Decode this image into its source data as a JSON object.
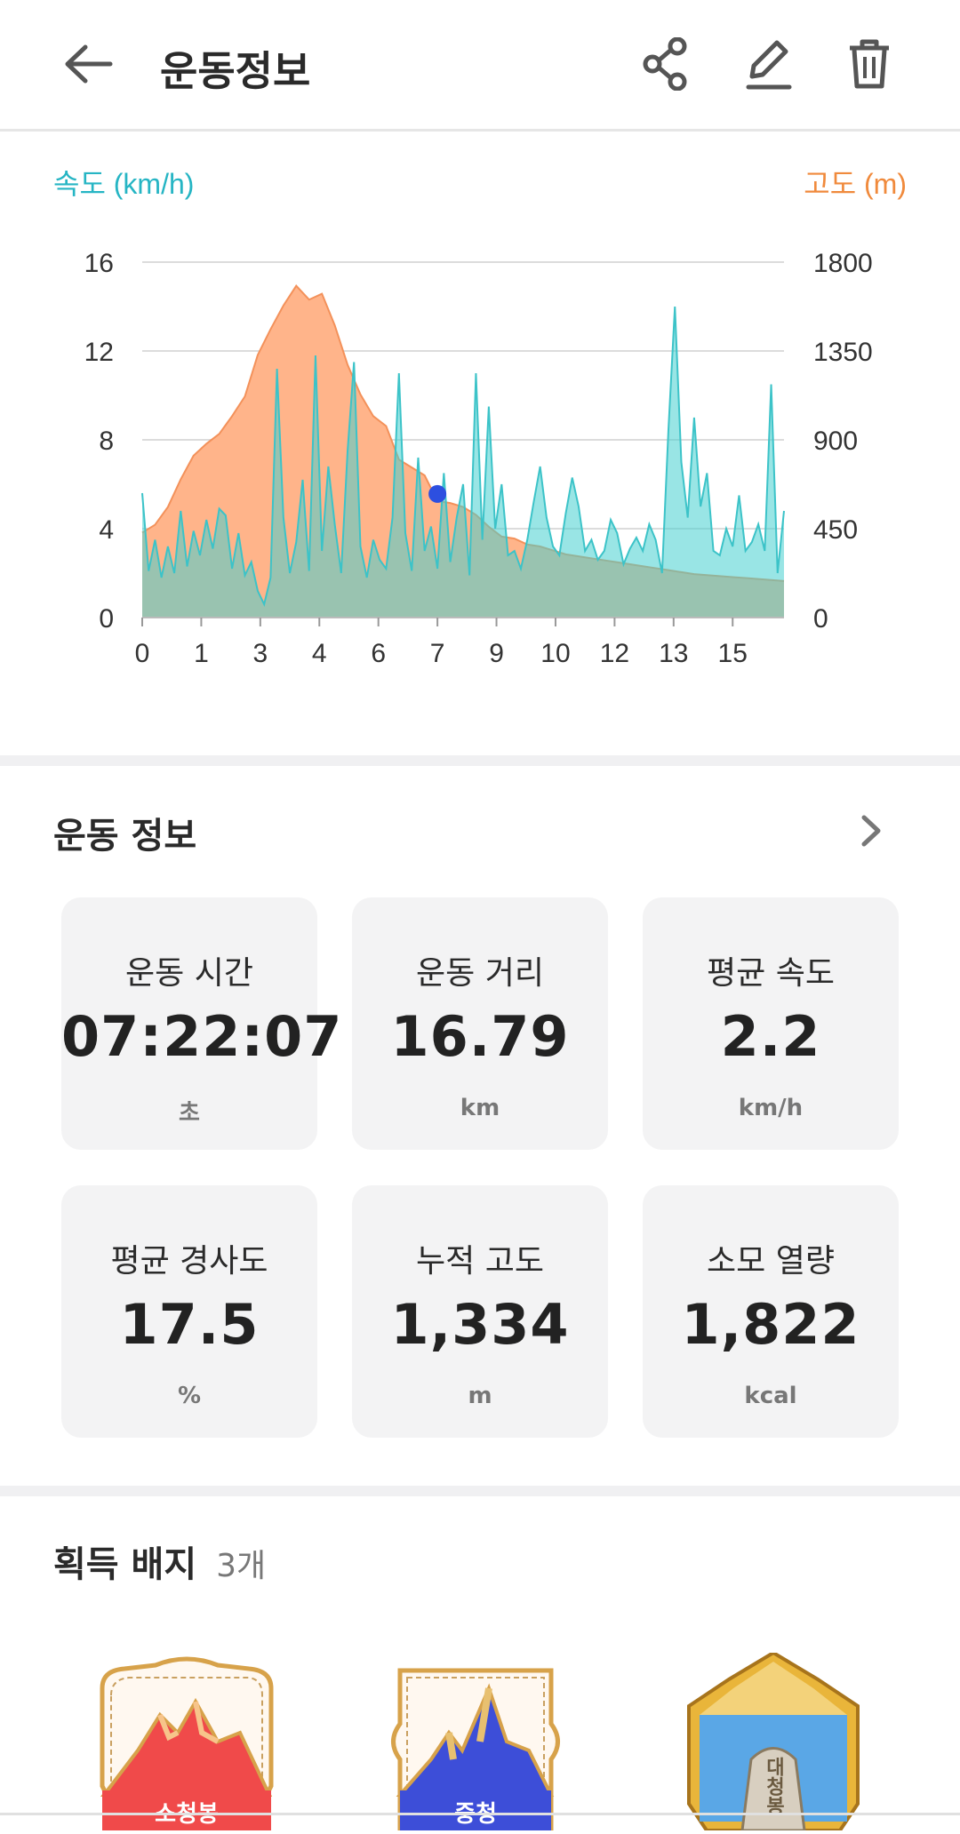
{
  "header": {
    "title": "운동정보",
    "back_icon": "arrow-left-icon",
    "share_icon": "share-icon",
    "edit_icon": "pencil-icon",
    "delete_icon": "trash-icon"
  },
  "chart_data": {
    "type": "area",
    "speed_axis_label": "속도 (km/h)",
    "altitude_axis_label": "고도 (m)",
    "x_ticks": [
      "0",
      "1",
      "3",
      "4",
      "6",
      "7",
      "9",
      "10",
      "12",
      "13",
      "15"
    ],
    "y_left_ticks": [
      "16",
      "12",
      "8",
      "4",
      "0"
    ],
    "y_right_ticks": [
      "1800",
      "1350",
      "900",
      "450",
      "0"
    ],
    "ylim_speed": [
      0,
      16
    ],
    "ylim_altitude": [
      0,
      1800
    ],
    "grid": true,
    "colors": {
      "speed": "#46cfd0",
      "altitude": "#ffb48a",
      "marker": "#2d4fe0",
      "speed_label": "#26b5c4",
      "altitude_label": "#f08a3c"
    },
    "series": [
      {
        "name": "고도 (m)",
        "x_norm": [
          0,
          0.02,
          0.04,
          0.06,
          0.08,
          0.1,
          0.12,
          0.14,
          0.16,
          0.18,
          0.2,
          0.22,
          0.24,
          0.26,
          0.28,
          0.3,
          0.32,
          0.34,
          0.36,
          0.38,
          0.4,
          0.42,
          0.44,
          0.46,
          0.48,
          0.5,
          0.52,
          0.54,
          0.56,
          0.58,
          0.6,
          0.62,
          0.64,
          0.66,
          0.68,
          0.7,
          0.72,
          0.74,
          0.76,
          0.78,
          0.8,
          0.82,
          0.84,
          0.86,
          0.88,
          0.9,
          0.92,
          0.94,
          0.96,
          0.98,
          1.0
        ],
        "values": [
          430,
          470,
          560,
          700,
          820,
          880,
          930,
          1020,
          1120,
          1330,
          1460,
          1580,
          1680,
          1610,
          1640,
          1480,
          1280,
          1130,
          1020,
          970,
          800,
          760,
          720,
          590,
          580,
          560,
          520,
          460,
          410,
          400,
          370,
          360,
          340,
          320,
          310,
          300,
          290,
          280,
          270,
          260,
          250,
          240,
          230,
          220,
          215,
          210,
          205,
          200,
          195,
          190,
          185
        ]
      },
      {
        "name": "속도 (km/h)",
        "x_norm": [
          0,
          0.01,
          0.02,
          0.03,
          0.04,
          0.05,
          0.06,
          0.07,
          0.08,
          0.09,
          0.1,
          0.11,
          0.12,
          0.13,
          0.14,
          0.15,
          0.16,
          0.17,
          0.18,
          0.19,
          0.2,
          0.21,
          0.22,
          0.23,
          0.24,
          0.25,
          0.26,
          0.27,
          0.28,
          0.29,
          0.3,
          0.31,
          0.32,
          0.33,
          0.34,
          0.35,
          0.36,
          0.37,
          0.38,
          0.39,
          0.4,
          0.41,
          0.42,
          0.43,
          0.44,
          0.45,
          0.46,
          0.47,
          0.48,
          0.49,
          0.5,
          0.51,
          0.52,
          0.53,
          0.54,
          0.55,
          0.56,
          0.57,
          0.58,
          0.59,
          0.6,
          0.61,
          0.62,
          0.63,
          0.64,
          0.65,
          0.66,
          0.67,
          0.68,
          0.69,
          0.7,
          0.71,
          0.72,
          0.73,
          0.74,
          0.75,
          0.76,
          0.77,
          0.78,
          0.79,
          0.8,
          0.81,
          0.82,
          0.83,
          0.84,
          0.85,
          0.86,
          0.87,
          0.88,
          0.89,
          0.9,
          0.91,
          0.92,
          0.93,
          0.94,
          0.95,
          0.96,
          0.97,
          0.98,
          0.99,
          1.0
        ],
        "values": [
          5.6,
          2.1,
          3.5,
          1.8,
          3.2,
          2.0,
          4.8,
          2.3,
          3.9,
          2.8,
          4.4,
          3.1,
          4.9,
          4.6,
          2.2,
          3.8,
          1.9,
          2.5,
          1.2,
          0.6,
          1.8,
          11.2,
          4.5,
          2.0,
          3.4,
          6.2,
          2.1,
          11.8,
          3.0,
          6.8,
          4.2,
          2.0,
          7.5,
          11.5,
          3.2,
          1.8,
          3.5,
          2.6,
          2.2,
          4.5,
          11.0,
          3.8,
          2.1,
          7.2,
          3.0,
          4.1,
          2.2,
          6.5,
          2.5,
          4.5,
          6.0,
          1.9,
          11.0,
          3.5,
          9.5,
          4.0,
          6.0,
          2.8,
          3.0,
          2.2,
          3.5,
          5.2,
          6.8,
          4.5,
          3.2,
          2.8,
          4.7,
          6.3,
          5.0,
          3.0,
          3.5,
          2.6,
          3.0,
          4.4,
          3.8,
          2.4,
          3.1,
          3.6,
          3.0,
          4.2,
          3.5,
          2.0,
          8.5,
          14.0,
          7.0,
          4.5,
          9.0,
          5.0,
          6.5,
          3.0,
          2.8,
          4.0,
          3.2,
          5.5,
          3.0,
          3.4,
          4.2,
          3.0,
          10.5,
          2.0,
          4.8
        ]
      }
    ],
    "max_marker_label_index": 23
  },
  "summary": {
    "title": "운동 정보",
    "more_icon": "chevron-right-icon",
    "stats": [
      {
        "label": "운동 시간",
        "value": "07:22:07",
        "unit": "초"
      },
      {
        "label": "운동 거리",
        "value": "16.79",
        "unit": "km"
      },
      {
        "label": "평균 속도",
        "value": "2.2",
        "unit": "km/h"
      },
      {
        "label": "평균 경사도",
        "value": "17.5",
        "unit": "%"
      },
      {
        "label": "누적 고도",
        "value": "1,334",
        "unit": "m"
      },
      {
        "label": "소모 열량",
        "value": "1,822",
        "unit": "kcal"
      }
    ]
  },
  "badges": {
    "title": "획득 배지",
    "count": "3개",
    "items": [
      {
        "name": "소청봉",
        "icon": "mountain-badge-red-icon"
      },
      {
        "name": "중청",
        "icon": "mountain-badge-blue-icon"
      },
      {
        "name": "대청봉",
        "icon": "mountain-badge-gold-icon"
      }
    ]
  }
}
